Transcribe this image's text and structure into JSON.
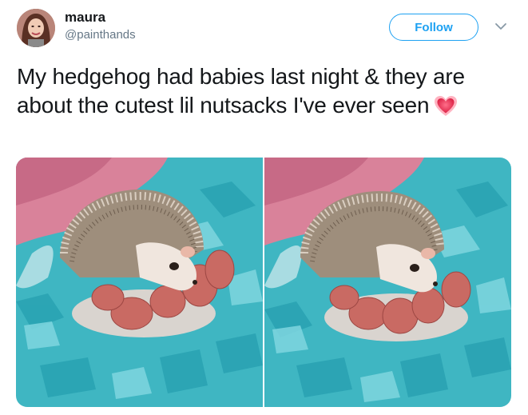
{
  "tweet": {
    "display_name": "maura",
    "handle": "@painthands",
    "follow_label": "Follow",
    "text": "My hedgehog had babies last night & they are about the cutest lil nutsacks I've ever seen"
  },
  "icons": {
    "avatar": "avatar",
    "caret": "chevron-down-icon",
    "emoji": "heart-emoji-icon"
  },
  "colors": {
    "accent": "#1da1f2",
    "secondary_text": "#657786",
    "primary_text": "#14171a",
    "heart": "#e8405e"
  }
}
